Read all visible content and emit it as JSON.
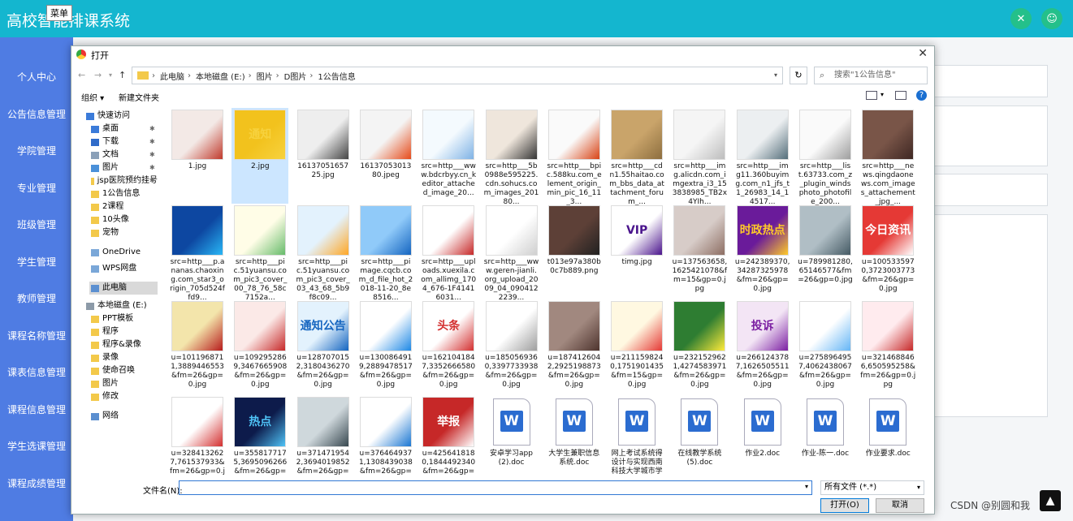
{
  "app": {
    "title": "高校智能排课系统",
    "menu_button": "菜单",
    "sidebar": [
      "个人中心",
      "公告信息管理",
      "学院管理",
      "专业管理",
      "班级管理",
      "学生管理",
      "教师管理",
      "课程名称管理",
      "课表信息管理",
      "课程信息管理",
      "学生选课管理",
      "课程成绩管理"
    ],
    "watermark": "CSDN @别圆和我"
  },
  "dialog": {
    "title": "打开",
    "breadcrumb": [
      "此电脑",
      "本地磁盘 (E:)",
      "图片",
      "D图片",
      "1公告信息"
    ],
    "search_placeholder": "搜索\"1公告信息\"",
    "toolbar": {
      "organize": "组织 ▾",
      "new_folder": "新建文件夹"
    },
    "tree": [
      {
        "label": "快速访问",
        "type": "star",
        "indent": 0
      },
      {
        "label": "桌面",
        "type": "desktop",
        "indent": 1,
        "pin": true
      },
      {
        "label": "下载",
        "type": "download",
        "indent": 1,
        "pin": true
      },
      {
        "label": "文档",
        "type": "doc",
        "indent": 1,
        "pin": true
      },
      {
        "label": "图片",
        "type": "pic",
        "indent": 1,
        "pin": true
      },
      {
        "label": "jsp医院预约挂号",
        "type": "folder",
        "indent": 1,
        "pin": true
      },
      {
        "label": "1公告信息",
        "type": "folder",
        "indent": 1
      },
      {
        "label": "2课程",
        "type": "folder",
        "indent": 1
      },
      {
        "label": "10头像",
        "type": "folder",
        "indent": 1
      },
      {
        "label": "宠物",
        "type": "folder",
        "indent": 1
      },
      {
        "label": "OneDrive",
        "type": "cloud",
        "indent": 1
      },
      {
        "label": "WPS网盘",
        "type": "cloud",
        "indent": 1
      },
      {
        "label": "此电脑",
        "type": "pc",
        "indent": 1,
        "selected": true
      },
      {
        "label": "本地磁盘 (E:)",
        "type": "drive",
        "indent": 0
      },
      {
        "label": "PPT模板",
        "type": "folder",
        "indent": 1
      },
      {
        "label": "程序",
        "type": "folder",
        "indent": 1
      },
      {
        "label": "程序&录像",
        "type": "folder",
        "indent": 1
      },
      {
        "label": "录像",
        "type": "folder",
        "indent": 1
      },
      {
        "label": "使命召唤",
        "type": "folder",
        "indent": 1
      },
      {
        "label": "图片",
        "type": "folder",
        "indent": 1
      },
      {
        "label": "修改",
        "type": "folder",
        "indent": 1
      },
      {
        "label": "网络",
        "type": "network",
        "indent": 1
      }
    ],
    "files": [
      {
        "name": "1.jpg",
        "kind": "img",
        "c1": "#f3e9e6",
        "c2": "#c0392b"
      },
      {
        "name": "2.jpg",
        "kind": "img",
        "c1": "#f2c21d",
        "c2": "#f7d23e",
        "text": "通知",
        "selected": true
      },
      {
        "name": "1613705165725.jpg",
        "kind": "img",
        "c1": "#eeeeee",
        "c2": "#444444"
      },
      {
        "name": "1613705301380.jpeg",
        "kind": "img",
        "c1": "#f4f4f4",
        "c2": "#e64a19"
      },
      {
        "name": "src=http___www.bdcrbyy.cn_keditor_attached_image_20...",
        "kind": "img",
        "c1": "#f4fafe",
        "c2": "#7fb2e5"
      },
      {
        "name": "src=http___5b0988e595225.cdn.sohucs.com_images_20180...",
        "kind": "img",
        "c1": "#efe6dc",
        "c2": "#333333"
      },
      {
        "name": "src=http___bpic.588ku.com_element_origin_min_pic_16_11_3...",
        "kind": "img",
        "c1": "#fafafa",
        "c2": "#d84315"
      },
      {
        "name": "src=http___cdn1.55haitao.com_bbs_data_attachment_forum_...",
        "kind": "img",
        "c1": "#c9a46a",
        "c2": "#8d6e3f"
      },
      {
        "name": "src=http___img.alicdn.com_imgextra_i3_153838985_TB2x4YIh...",
        "kind": "img",
        "c1": "#f5f5f5",
        "c2": "#bdbdbd"
      },
      {
        "name": "src=http___img11.360buyimg.com_n1_jfs_t1_26983_14_14517...",
        "kind": "img",
        "c1": "#eceff1",
        "c2": "#546e7a"
      },
      {
        "name": "src=http___list.63733.com_z_plugin_windsphoto_photofile_200...",
        "kind": "img",
        "c1": "#fafafa",
        "c2": "#9e9e9e"
      },
      {
        "name": "src=http___news.qingdaonews.com_images_attachement_jpg_...",
        "kind": "img",
        "c1": "#795548",
        "c2": "#3e2723"
      },
      {
        "name": "src=http___p.ananas.chaoxing.com_star3_origin_705d524ffd9...",
        "kind": "img",
        "c1": "#0d47a1",
        "c2": "#29b6f6"
      },
      {
        "name": "src=http___pic.51yuansu.com_pic3_cover_00_78_76_58c7152a...",
        "kind": "img",
        "c1": "#fffde7",
        "c2": "#66bb6a"
      },
      {
        "name": "src=http___pic.51yuansu.com_pic3_cover_03_43_68_5b9f8c09...",
        "kind": "img",
        "c1": "#e3f2fd",
        "c2": "#ffa726"
      },
      {
        "name": "src=http___pimage.cqcb.com_d_file_hot_2018-11-20_8e8516...",
        "kind": "img",
        "c1": "#90caf9",
        "c2": "#1565c0"
      },
      {
        "name": "src=http___uploads.xuexila.com_allimg_1704_676-1F41416031...",
        "kind": "img",
        "c1": "#ffffff",
        "c2": "#c62828"
      },
      {
        "name": "src=http___www.geren-jianli.org_upload_2009_04_0904122239...",
        "kind": "img",
        "c1": "#ffffff",
        "c2": "#cfcfcf"
      },
      {
        "name": "t013e97a380b0c7b889.png",
        "kind": "img",
        "c1": "#5d4037",
        "c2": "#212121"
      },
      {
        "name": "timg.jpg",
        "kind": "img",
        "c1": "#ffffff",
        "c2": "#4a148c",
        "text": "VIP"
      },
      {
        "name": "u=137563658,1625421078&fm=15&gp=0.jpg",
        "kind": "img",
        "c1": "#d7ccc8",
        "c2": "#8d6e63"
      },
      {
        "name": "u=242389370,34287325978&fm=26&gp=0.jpg",
        "kind": "img",
        "c1": "#6a1b9a",
        "c2": "#ffca28",
        "text": "时政热点"
      },
      {
        "name": "u=789981280,65146577&fm=26&gp=0.jpg",
        "kind": "img",
        "c1": "#b0bec5",
        "c2": "#455a64"
      },
      {
        "name": "u=1005335970,3723003773&fm=26&gp=0.jpg",
        "kind": "img",
        "c1": "#e53935",
        "c2": "#ffffff",
        "text": "今日资讯"
      },
      {
        "name": "u=1011968711,3889446553&fm=26&gp=0.jpg",
        "kind": "img",
        "c1": "#f3e5ab",
        "c2": "#b71c1c"
      },
      {
        "name": "u=1092952869,3467665908&fm=26&gp=0.jpg",
        "kind": "img",
        "c1": "#fbe9e7",
        "c2": "#c62828"
      },
      {
        "name": "u=1287070152,3180436270&fm=26&gp=0.jpg",
        "kind": "img",
        "c1": "#e3f2fd",
        "c2": "#1565c0",
        "text": "通知公告"
      },
      {
        "name": "u=1300864919,2889478517&fm=26&gp=0.jpg",
        "kind": "img",
        "c1": "#ffffff",
        "c2": "#1e88e5"
      },
      {
        "name": "u=1621041847,3352666580&fm=26&gp=0.jpg",
        "kind": "img",
        "c1": "#ffffff",
        "c2": "#d32f2f",
        "text": "头条"
      },
      {
        "name": "u=1850569360,3397733938&fm=26&gp=0.jpg",
        "kind": "img",
        "c1": "#ffffff",
        "c2": "#9e9e9e"
      },
      {
        "name": "u=1874126042,2925198873&fm=26&gp=0.jpg",
        "kind": "img",
        "c1": "#a1887f",
        "c2": "#4e342e"
      },
      {
        "name": "u=2111598240,1751901435&fm=15&gp=0.jpg",
        "kind": "img",
        "c1": "#fff8e1",
        "c2": "#e53935"
      },
      {
        "name": "u=2321529621,4274583971&fm=26&gp=0.jpg",
        "kind": "img",
        "c1": "#2e7d32",
        "c2": "#ffeb3b"
      },
      {
        "name": "u=2661243787,1626505511&fm=26&gp=0.jpg",
        "kind": "img",
        "c1": "#f3e5f5",
        "c2": "#7b1fa2",
        "text": "投诉"
      },
      {
        "name": "u=2758964957,4062438067&fm=26&gp=0.jpg",
        "kind": "img",
        "c1": "#ffffff",
        "c2": "#64b5f6"
      },
      {
        "name": "u=3214688466,650595258&fm=26&gp=0.jpg",
        "kind": "img",
        "c1": "#ffebee",
        "c2": "#c62828"
      },
      {
        "name": "u=3284132627,761537933&fm=26&gp=0.jpg",
        "kind": "img",
        "c1": "#ffffff",
        "c2": "#d32f2f"
      },
      {
        "name": "u=3558177175,3695096266&fm=26&gp=0.jpg",
        "kind": "img",
        "c1": "#0d1b4b",
        "c2": "#4fc3f7",
        "text": "热点"
      },
      {
        "name": "u=3714719542,3694019852&fm=26&gp=0.jpg",
        "kind": "img",
        "c1": "#cfd8dc",
        "c2": "#37474f"
      },
      {
        "name": "u=3764649371,1308439038&fm=26&gp=0.jpg",
        "kind": "img",
        "c1": "#ffffff",
        "c2": "#1976d2"
      },
      {
        "name": "u=4256418180,1844492340&fm=26&gp=0.jpg",
        "kind": "img",
        "c1": "#c62828",
        "c2": "#ffffff",
        "text": "举报"
      },
      {
        "name": "安卓学习app(2).doc",
        "kind": "doc"
      },
      {
        "name": "大学生兼职信息系统.doc",
        "kind": "doc"
      },
      {
        "name": "网上考试系统得设计与实现西南科技大学城市学院",
        "kind": "doc"
      },
      {
        "name": "在线教学系统(5).doc",
        "kind": "doc"
      },
      {
        "name": "作业2.doc",
        "kind": "doc"
      },
      {
        "name": "作业-陈一.doc",
        "kind": "doc"
      },
      {
        "name": "作业要求.doc",
        "kind": "doc"
      }
    ],
    "filename_label": "文件名(N):",
    "filename_value": "",
    "filetype": "所有文件 (*.*)",
    "open_button": "打开(O)",
    "cancel_button": "取消"
  }
}
